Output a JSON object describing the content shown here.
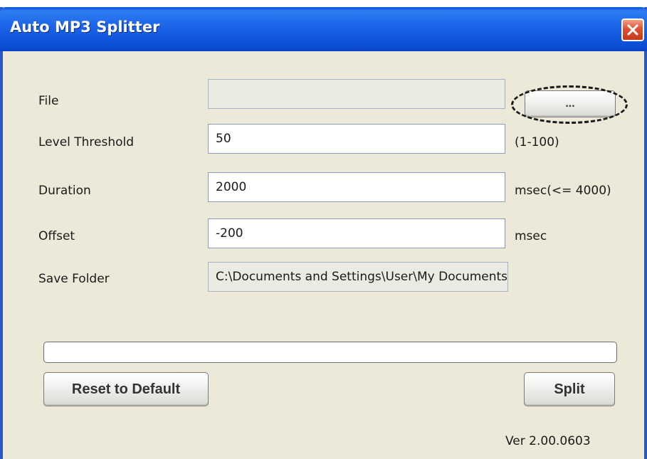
{
  "window": {
    "title": "Auto MP3 Splitter"
  },
  "form": {
    "file": {
      "label": "File",
      "value": "",
      "browse_label": "..."
    },
    "level_threshold": {
      "label": "Level Threshold",
      "value": "50",
      "unit": "(1-100)"
    },
    "duration": {
      "label": "Duration",
      "value": "2000",
      "unit": "msec(<= 4000)"
    },
    "offset": {
      "label": "Offset",
      "value": "-200",
      "unit": "msec"
    },
    "save_folder": {
      "label": "Save Folder",
      "value": "C:\\Documents and Settings\\User\\My Documents"
    }
  },
  "progress": {
    "percent": 0
  },
  "buttons": {
    "reset_label": "Reset to Default",
    "split_label": "Split"
  },
  "version": "Ver 2.00.0603",
  "icons": {
    "close": "close-icon"
  },
  "colors": {
    "titlebar": "#1b64e8",
    "close_button": "#e0502f",
    "window_bg": "#ece9d8"
  }
}
